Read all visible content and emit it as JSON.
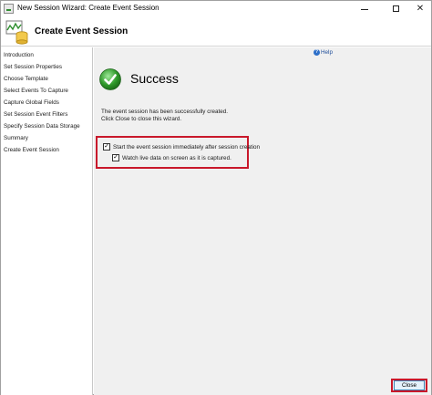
{
  "window": {
    "title": "New Session Wizard: Create Event Session",
    "min_glyph": "",
    "max_glyph": "",
    "close_glyph": "✕"
  },
  "header": {
    "title": "Create Event Session"
  },
  "sidebar": {
    "items": [
      {
        "label": "Introduction"
      },
      {
        "label": "Set Session Properties"
      },
      {
        "label": "Choose Template"
      },
      {
        "label": "Select Events To Capture"
      },
      {
        "label": "Capture Global Fields"
      },
      {
        "label": "Set Session Event Filters"
      },
      {
        "label": "Specify Session Data Storage"
      },
      {
        "label": "Summary"
      },
      {
        "label": "Create Event Session"
      }
    ]
  },
  "main": {
    "help_label": "Help",
    "help_icon_glyph": "?",
    "success_title": "Success",
    "message_line1": "The event session has been successfully created.",
    "message_line2": "Click Close to close this wizard.",
    "checkbox_start": {
      "label": "Start the event session immediately after session creation",
      "checked": true,
      "glyph": "✓"
    },
    "checkbox_watch": {
      "label": "Watch live data on screen as it is captured.",
      "checked": true,
      "glyph": "✓"
    }
  },
  "footer": {
    "close_label": "Close"
  },
  "colors": {
    "highlight": "#c9182b",
    "success_green": "#2f9a2a",
    "link_blue": "#1f4e9a"
  }
}
